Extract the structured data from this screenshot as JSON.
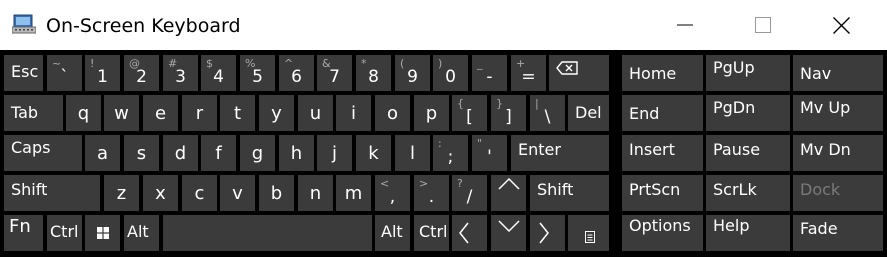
{
  "window": {
    "title": "On-Screen Keyboard",
    "icon": "keyboard-app-icon"
  },
  "colors": {
    "key_bg": "#3b3b3b",
    "key_text": "#ffffff",
    "shift_text": "#aaaaaa",
    "disabled_text": "#7a7a7a",
    "background": "#000000"
  },
  "keys": {
    "esc": "Esc",
    "backtick": {
      "shift": "~",
      "main": "`"
    },
    "d1": {
      "shift": "!",
      "main": "1"
    },
    "d2": {
      "shift": "@",
      "main": "2"
    },
    "d3": {
      "shift": "#",
      "main": "3"
    },
    "d4": {
      "shift": "$",
      "main": "4"
    },
    "d5": {
      "shift": "%",
      "main": "5"
    },
    "d6": {
      "shift": "^",
      "main": "6"
    },
    "d7": {
      "shift": "&",
      "main": "7"
    },
    "d8": {
      "shift": "*",
      "main": "8"
    },
    "d9": {
      "shift": "(",
      "main": "9"
    },
    "d0": {
      "shift": ")",
      "main": "0"
    },
    "minus": {
      "shift": "_",
      "main": "-"
    },
    "equals": {
      "shift": "+",
      "main": "="
    },
    "tab": "Tab",
    "q": "q",
    "w": "w",
    "e": "e",
    "r": "r",
    "t": "t",
    "y": "y",
    "u": "u",
    "i": "i",
    "o": "o",
    "p": "p",
    "lbracket": {
      "shift": "{",
      "main": "["
    },
    "rbracket": {
      "shift": "}",
      "main": "]"
    },
    "backslash": {
      "shift": "|",
      "main": "\\"
    },
    "del": "Del",
    "caps": "Caps",
    "a": "a",
    "s": "s",
    "d": "d",
    "f": "f",
    "g": "g",
    "h": "h",
    "j": "j",
    "k": "k",
    "l": "l",
    "semicolon": {
      "shift": ":",
      "main": ";"
    },
    "quote": {
      "shift": "\"",
      "main": "'"
    },
    "enter": "Enter",
    "shift": "Shift",
    "z": "z",
    "x": "x",
    "c": "c",
    "v": "v",
    "b": "b",
    "n": "n",
    "m": "m",
    "comma": {
      "shift": "<",
      "main": ","
    },
    "period": {
      "shift": ">",
      "main": "."
    },
    "slash": {
      "shift": "?",
      "main": "/"
    },
    "fn": "Fn",
    "ctrl": "Ctrl",
    "alt": "Alt",
    "home": "Home",
    "pgup": "PgUp",
    "nav": "Nav",
    "end": "End",
    "pgdn": "PgDn",
    "mvup": "Mv Up",
    "insert": "Insert",
    "pause": "Pause",
    "mvdn": "Mv Dn",
    "prtscn": "PrtScn",
    "scrlk": "ScrLk",
    "dock": "Dock",
    "options": "Options",
    "help": "Help",
    "fade": "Fade"
  }
}
